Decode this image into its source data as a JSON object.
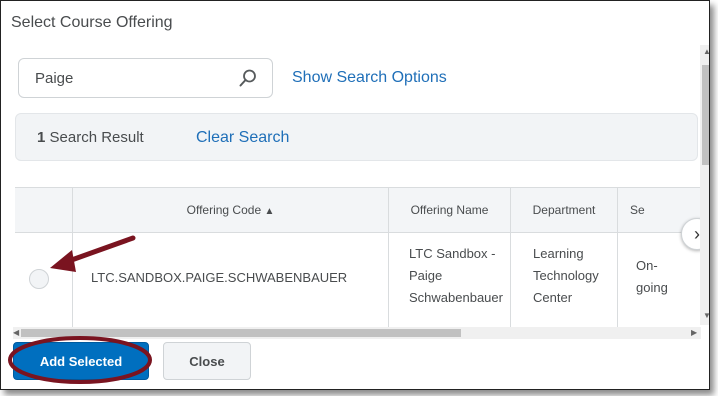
{
  "dialog": {
    "title": "Select Course Offering"
  },
  "search": {
    "value": "Paige",
    "show_options_label": "Show Search Options"
  },
  "results": {
    "count": "1",
    "count_label": "Search Result",
    "clear_label": "Clear Search"
  },
  "table": {
    "headers": {
      "code": "Offering Code",
      "name": "Offering Name",
      "department": "Department",
      "semester": "Se"
    },
    "sort_indicator": "▲",
    "rows": [
      {
        "code": "LTC.SANDBOX.PAIGE.SCHWABENBAUER",
        "name_lines": [
          "LTC Sandbox -",
          "Paige",
          "Schwabenbauer"
        ],
        "department_lines": [
          "Learning",
          "Technology",
          "Center"
        ],
        "semester_lines": [
          "On-",
          "going"
        ]
      }
    ]
  },
  "footer": {
    "add_label": "Add Selected",
    "close_label": "Close"
  },
  "icons": {
    "search": "search-icon",
    "next_column": "chevron-right-icon",
    "annotation_arrow": "arrow-annotation-icon",
    "annotation_ellipse": "ellipse-annotation"
  },
  "colors": {
    "link": "#1f6fb8",
    "primary_button": "#006fbf",
    "annotation": "#7a1420"
  }
}
